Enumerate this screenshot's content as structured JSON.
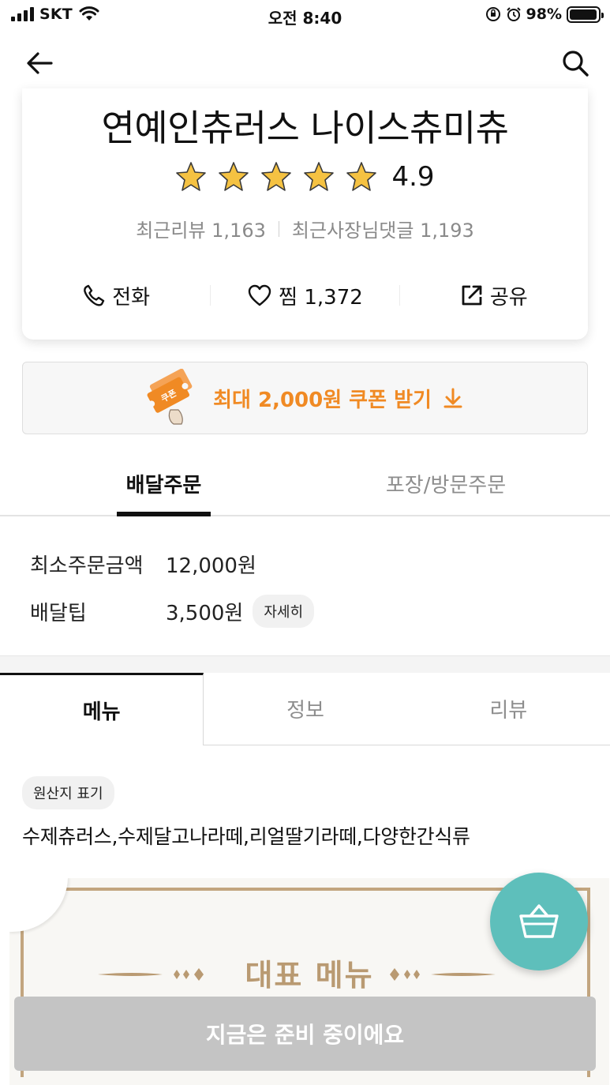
{
  "status_bar": {
    "carrier": "SKT",
    "time": "오전 8:40",
    "battery": "98%",
    "battery_level": 0.98,
    "icons": [
      "signal-icon",
      "wifi-icon",
      "rotation-lock-icon",
      "alarm-icon",
      "battery-icon"
    ]
  },
  "header": {
    "icons": [
      "back-arrow-icon",
      "search-icon"
    ]
  },
  "store": {
    "name": "연예인츄러스 나이스츄미츄",
    "rating": "4.9",
    "star_count": 5,
    "recent_reviews": "최근리뷰 1,163",
    "owner_replies": "최근사장님댓글 1,193",
    "actions": {
      "call": "전화",
      "favorite": "찜 1,372",
      "share": "공유"
    }
  },
  "coupon": {
    "label": "최대 2,000원 쿠폰 받기",
    "ticket_text": "쿠폰",
    "accent_color": "#f08a24"
  },
  "order_tabs": {
    "delivery": "배달주문",
    "pickup": "포장/방문주문"
  },
  "delivery_info": {
    "min_order_label": "최소주문금액",
    "min_order_value": "12,000원",
    "tip_label": "배달팁",
    "tip_value": "3,500원",
    "detail_button": "자세히"
  },
  "menu_tabs": {
    "menu": "메뉴",
    "info": "정보",
    "review": "리뷰"
  },
  "origin": {
    "pill": "원산지 표기",
    "text": "수제츄러스,수제달고나라떼,리얼딸기라떼,다양한간식류"
  },
  "banner": {
    "title": "대표 메뉴",
    "accent_color": "#c2a57f"
  },
  "cart": {
    "icon": "basket-icon",
    "color": "#5ebfbb"
  },
  "bottom_button": {
    "label": "지금은 준비 중이에요"
  }
}
